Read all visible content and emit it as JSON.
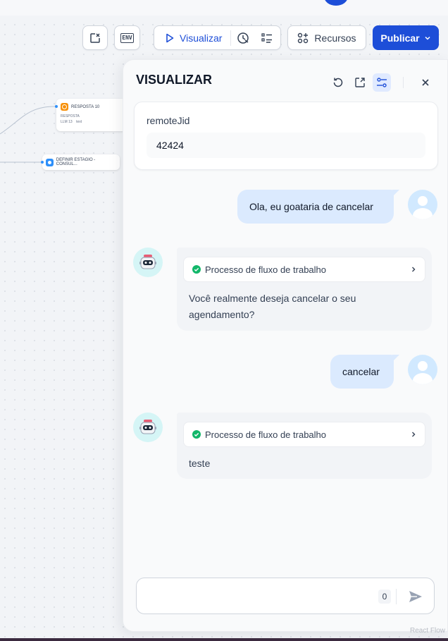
{
  "toolbar": {
    "close_tab_icon": "close-tab-icon",
    "env_label": "ENV",
    "visualizar_label": "Visualizar",
    "history_icon": "history-icon",
    "checklist_icon": "checklist-icon",
    "recursos_label": "Recursos",
    "publicar_label": "Publicar"
  },
  "canvas": {
    "node1": {
      "title": "RESPOSTA 10",
      "subtitle": "RESPOSTA",
      "tag1": "LLM 13",
      "tag2": "text"
    },
    "node2": {
      "title": "DEFINIR ESTAGIO - CONSUL..."
    },
    "watermark": "React Flow"
  },
  "panel": {
    "title": "VISUALIZAR",
    "variable": {
      "label": "remoteJid",
      "value": "42424"
    },
    "messages": [
      {
        "role": "user",
        "text": "Ola, eu goataria de cancelar"
      },
      {
        "role": "bot",
        "workflow_label": "Processo de fluxo de trabalho",
        "text": "Você realmente deseja cancelar o seu agendamento?"
      },
      {
        "role": "user",
        "text": "cancelar"
      },
      {
        "role": "bot",
        "workflow_label": "Processo de fluxo de trabalho",
        "text": "teste"
      }
    ],
    "composer": {
      "placeholder": "",
      "counter": "0"
    }
  },
  "colors": {
    "accent": "#1d4ed8",
    "user_bubble": "#dbeafe",
    "bot_bubble": "#f2f4f7",
    "success": "#12b76a"
  }
}
